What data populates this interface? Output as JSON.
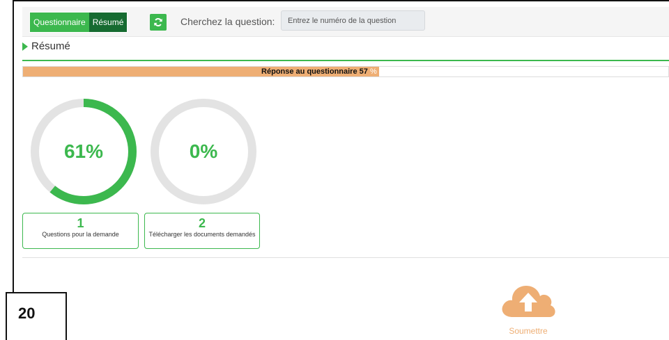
{
  "toolbar": {
    "tabs": [
      {
        "label": "Questionnaire",
        "active": true
      },
      {
        "label": "Résumé",
        "active": false
      }
    ],
    "refresh_icon": "refresh-icon",
    "search_label": "Cherchez la question:",
    "search_placeholder": "Entrez le numéro de la question"
  },
  "section": {
    "title": "Résumé",
    "icon": "caret-right-icon"
  },
  "progress": {
    "label": "Réponse au questionnaire 57",
    "percent_sign": "%",
    "value": 57
  },
  "gauges": [
    {
      "value_label": "61%",
      "value": 61
    },
    {
      "value_label": "0%",
      "value": 0
    }
  ],
  "steps": [
    {
      "number": "1",
      "label": "Questions pour la demande"
    },
    {
      "number": "2",
      "label": "Télécharger les documents demandés"
    }
  ],
  "submit": {
    "label": "Soumettre",
    "icon": "cloud-upload-icon"
  },
  "page_number": "20",
  "colors": {
    "green": "#3cb84e",
    "dark_green": "#166b31",
    "orange": "#eeae74",
    "gauge_track": "#e3e3e3"
  }
}
